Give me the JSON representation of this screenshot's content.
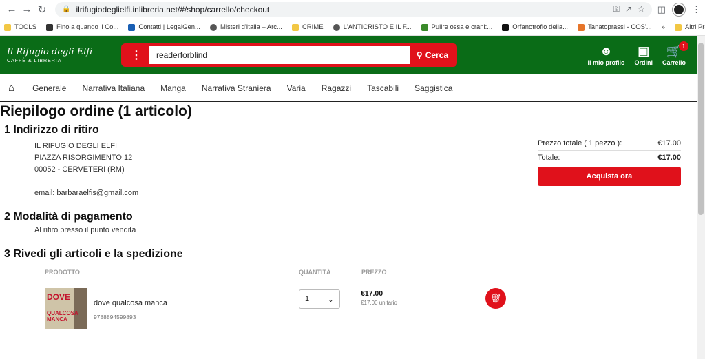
{
  "browser": {
    "url": "ilrifugiodeglielfi.inlibreria.net/#/shop/carrello/checkout",
    "bookmarks": [
      "TOOLS",
      "Fino a quando il Co...",
      "Contatti | LegalGen...",
      "Misteri d'Italia – Arc...",
      "CRIME",
      "L'ANTICRISTO E IL F...",
      "Pulire ossa e crani:...",
      "Orfanotrofio della...",
      "Tanatoprassi - COS'..."
    ],
    "more_bookmarks": "»",
    "other_bookmarks": "Altri Preferiti"
  },
  "header": {
    "logo_line1": "Il Rifugio degli Elfi",
    "logo_line2": "CAFFÈ & LIBRERIA",
    "search_value": "readerforblind",
    "search_button": "Cerca",
    "profile_label": "Il mio profilo",
    "orders_label": "Ordini",
    "cart_label": "Carrello",
    "cart_count": "1"
  },
  "categories": [
    "Generale",
    "Narrativa Italiana",
    "Manga",
    "Narrativa Straniera",
    "Varia",
    "Ragazzi",
    "Tascabili",
    "Saggistica"
  ],
  "page": {
    "title": "Riepilogo ordine (1 articolo)",
    "section1": "1 Indirizzo di ritiro",
    "addr1": "IL RIFUGIO DEGLI ELFI",
    "addr2": "PIAZZA RISORGIMENTO 12",
    "addr3": "00052 - CERVETERI (RM)",
    "email": "email: barbaraelfis@gmail.com",
    "section2": "2 Modalità di pagamento",
    "payment": "Al ritiro presso il punto vendita",
    "section3": "3 Rivedi gli articoli e la spedizione"
  },
  "table": {
    "col_product": "PRODOTTO",
    "col_qty": "QUANTITÀ",
    "col_price": "PREZZO"
  },
  "item": {
    "cover_title": "DOVE",
    "cover_subtitle": "QUALCOSA MANCA",
    "name": "dove qualcosa manca",
    "isbn": "9788894599893",
    "qty": "1",
    "price": "€17.00",
    "unit_price": "€17.00 unitario"
  },
  "summary": {
    "subtotal_label": "Prezzo totale ( 1 pezzo ):",
    "subtotal_value": "€17.00",
    "total_label": "Totale:",
    "total_value": "€17.00",
    "buy_button": "Acquista ora"
  }
}
